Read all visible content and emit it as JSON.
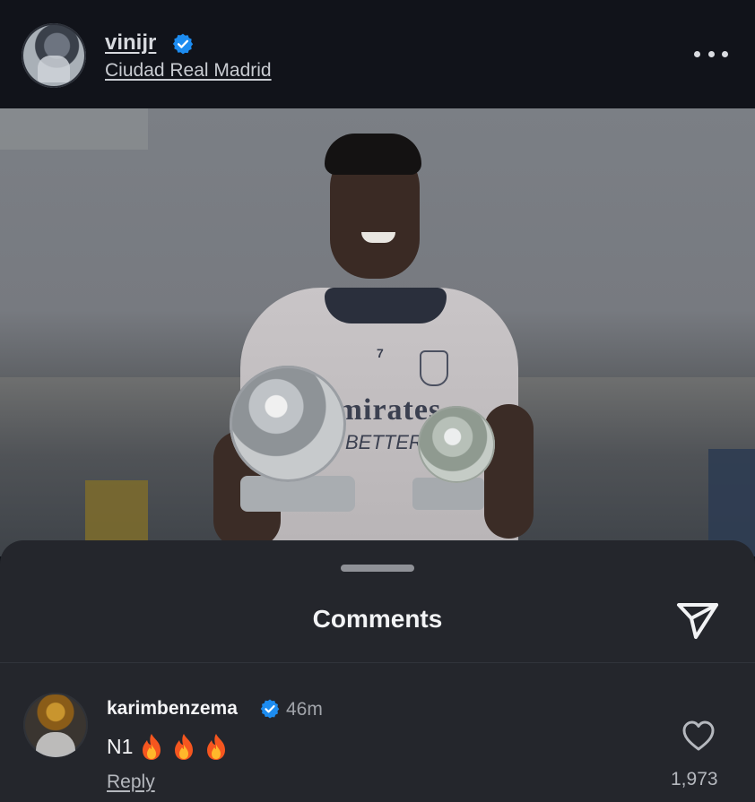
{
  "post": {
    "username": "vinijr",
    "location": "Ciudad Real Madrid",
    "photo": {
      "sponsor_text": "Emirates",
      "sponsor_sub": "BETTER",
      "shirt_number": "7"
    }
  },
  "comments_sheet": {
    "title": "Comments",
    "comments": [
      {
        "username": "karimbenzema",
        "time": "46m",
        "text": "N1",
        "reply_label": "Reply",
        "likes": "1,973"
      }
    ]
  },
  "colors": {
    "background": "#0f1218",
    "sheet": "#24262c",
    "verified": "#1d8cf0",
    "text_primary": "#f4f4f6",
    "text_secondary": "#a1a4aa"
  },
  "icons": [
    "verified-icon",
    "more-icon",
    "send-icon",
    "heart-icon",
    "fire-emoji"
  ]
}
